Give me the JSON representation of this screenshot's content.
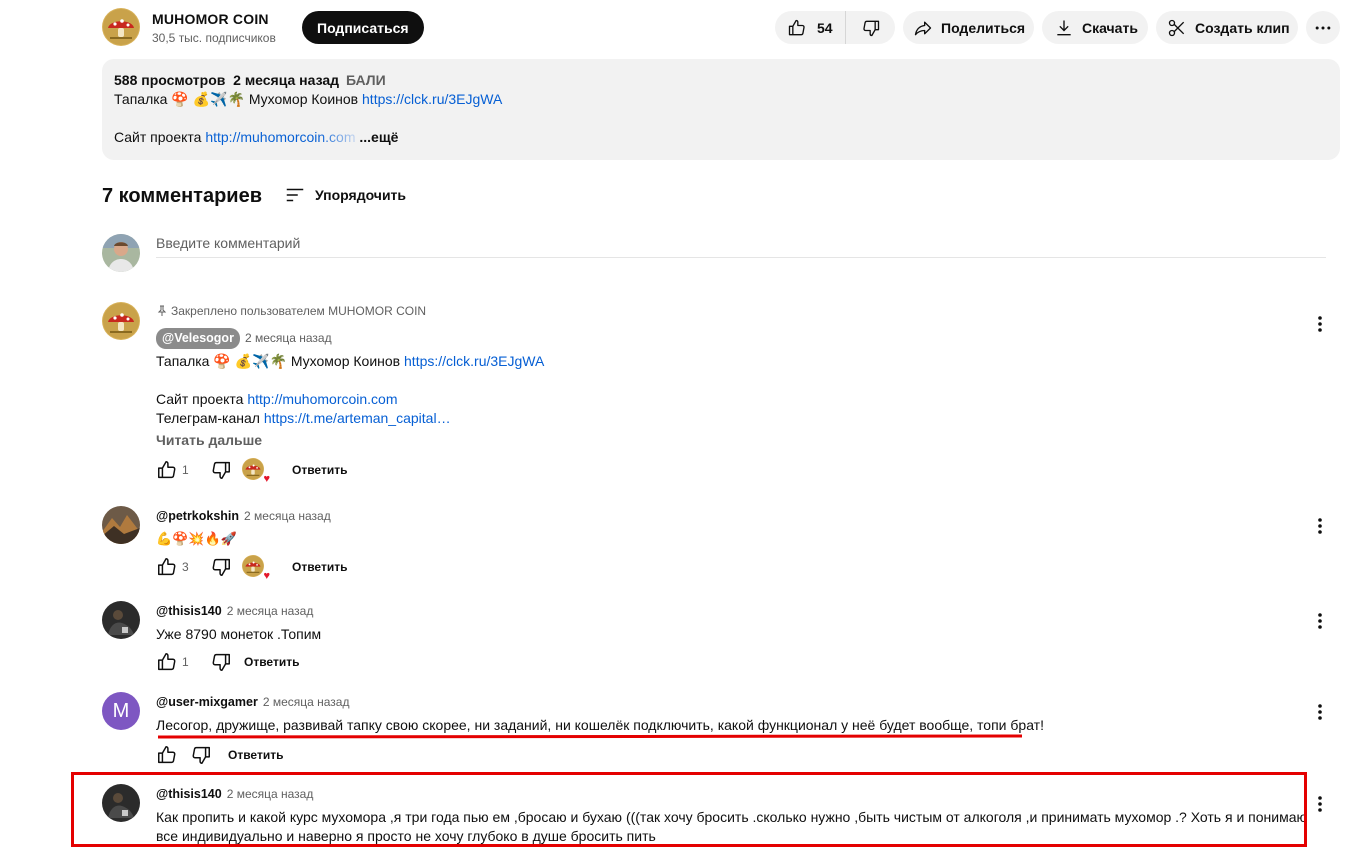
{
  "channel": {
    "name": "MUHOMOR COIN",
    "subscribers": "30,5 тыс. подписчиков",
    "subscribe_label": "Подписаться"
  },
  "actions": {
    "likes": "54",
    "share": "Поделиться",
    "download": "Скачать",
    "clip": "Создать клип"
  },
  "description": {
    "views": "588 просмотров",
    "date": "2 месяца назад",
    "tag": "БАЛИ",
    "line1_text": "Тапалка 🍄 💰✈️🌴 Мухомор Коинов ",
    "line1_link": "https://clck.ru/3EJgWA",
    "line2_text": "Сайт проекта ",
    "line2_link": "http://muhomorcoin.com",
    "more": "...ещё"
  },
  "comments_header": {
    "count": "7 комментариев",
    "sort": "Упорядочить"
  },
  "comment_input": {
    "placeholder": "Введите комментарий"
  },
  "comments": [
    {
      "pinned": "Закреплено пользователем MUHOMOR COIN",
      "author": "@Velesogor",
      "time": "2 месяца назад",
      "l1_text": "Тапалка 🍄 💰✈️🌴 Мухомор Коинов ",
      "l1_link": "https://clck.ru/3EJgWA",
      "l2_text": "Сайт проекта ",
      "l2_link": "http://muhomorcoin.com",
      "l3_text": "Телеграм-канал ",
      "l3_link": "https://t.me/arteman_capital…",
      "read_more": "Читать дальше",
      "likes": "1",
      "reply": "Ответить"
    },
    {
      "author": "@petrkokshin",
      "time": "2 месяца назад",
      "text": "💪🍄💥🔥🚀",
      "likes": "3",
      "reply": "Ответить"
    },
    {
      "author": "@thisis140",
      "time": "2 месяца назад",
      "text": "Уже 8790 монеток .Топим",
      "likes": "1",
      "reply": "Ответить"
    },
    {
      "author": "@user-mixgamer",
      "avatar_letter": "M",
      "time": "2 месяца назад",
      "text": "Лесогор, дружище, развивай тапку свою скорее, ни заданий, ни кошелёк подключить, какой функционал у неё будет вообще, топи брат!",
      "reply": "Ответить"
    },
    {
      "author": "@thisis140",
      "time": "2 месяца назад",
      "text1": "Как пропить и какой курс мухомора ,я три года пью ем ,бросаю и бухаю (((так хочу бросить .сколько нужно ,быть чистым от алкоголя ,и принимать мухомор .? Хоть я и понимаю",
      "text2": "все индивидуально и наверно я просто не хочу глубоко в душе бросить пить"
    }
  ],
  "colors": {
    "accent_link": "#065fd4",
    "annotation_red": "#e40000",
    "mixgamer_avatar": "#7e57c2"
  }
}
